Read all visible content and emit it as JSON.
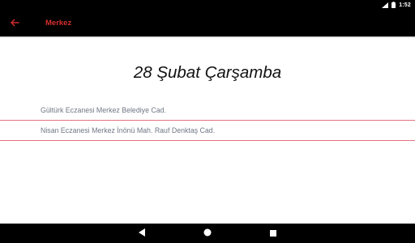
{
  "status_bar": {
    "time": "1:52",
    "icons": [
      "wifi-icon",
      "battery-icon"
    ]
  },
  "toolbar": {
    "title": "Merkez",
    "back_icon": "arrow-back-icon",
    "accent_color": "#d62f2f",
    "background": "#000000"
  },
  "main": {
    "date_heading": "28 Şubat Çarşamba",
    "pharmacies": [
      {
        "text": "Gültürk Eczanesi Merkez Belediye Cad."
      },
      {
        "text": "Nisan Eczanesi Merkez İnönü Mah. Rauf Denktaş Cad."
      }
    ],
    "divider_color": "#e57380",
    "item_text_color": "#6f7785"
  },
  "nav_bar": {
    "buttons": [
      "nav-back-icon",
      "nav-home-icon",
      "nav-recents-icon"
    ]
  }
}
